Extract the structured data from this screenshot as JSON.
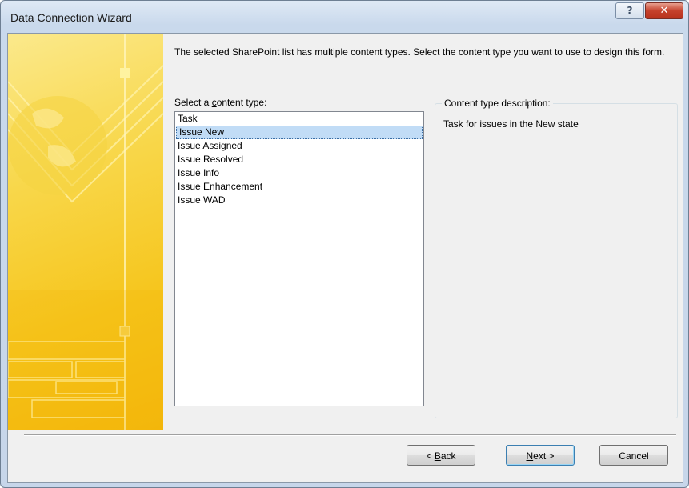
{
  "window": {
    "title": "Data Connection Wizard",
    "help_glyph": "?",
    "close_glyph": "✕"
  },
  "intro_text": "The selected SharePoint list has multiple content types. Select the content type you want to use to design this form.",
  "content_type_list": {
    "label_pre": "Select a ",
    "label_accel": "c",
    "label_post": "ontent type:",
    "items": [
      "Task",
      "Issue New",
      "Issue Assigned",
      "Issue Resolved",
      "Issue Info",
      "Issue Enhancement",
      "Issue WAD"
    ],
    "selected": "Issue New"
  },
  "description_group": {
    "title": "Content type description:",
    "text": "Task for issues in the New state"
  },
  "buttons": {
    "back_pre": "< ",
    "back_accel": "B",
    "back_post": "ack",
    "next_accel": "N",
    "next_post": "ext >",
    "cancel": "Cancel"
  },
  "colors": {
    "banner_accent": "#f6c51c",
    "selection": "#c1dcf6"
  }
}
